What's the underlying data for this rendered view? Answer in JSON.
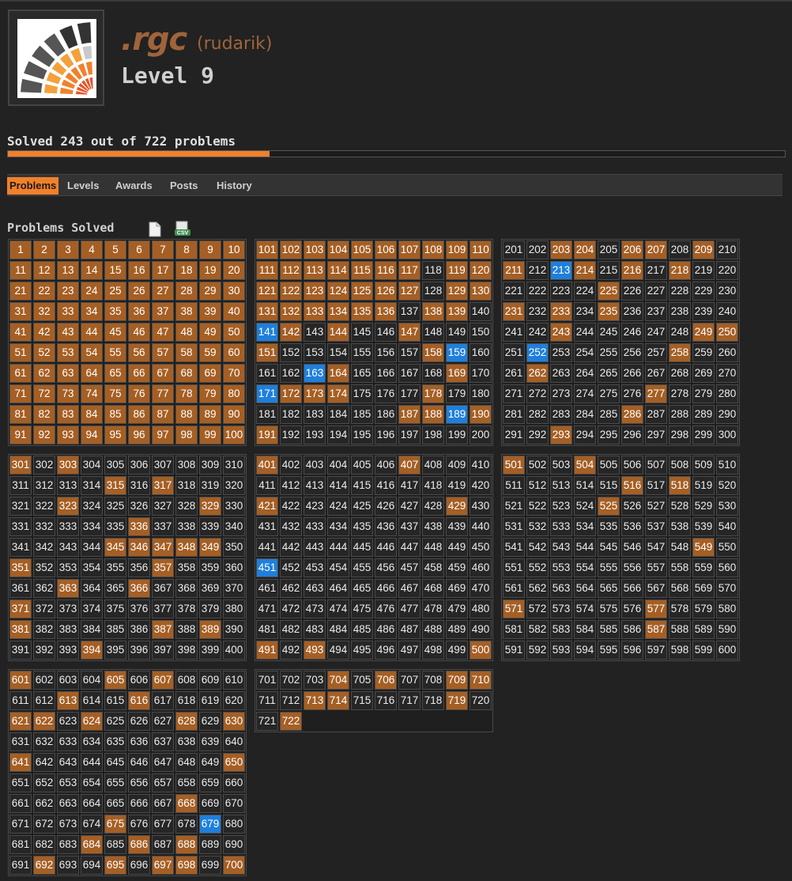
{
  "profile": {
    "username": ".rgc",
    "realname": "(rudarik)",
    "level": "Level 9"
  },
  "progress": {
    "text": "Solved 243 out of 722 problems",
    "solved": 243,
    "total": 722
  },
  "tabs": [
    {
      "label": "Problems",
      "active": true
    },
    {
      "label": "Levels",
      "active": false
    },
    {
      "label": "Awards",
      "active": false
    },
    {
      "label": "Posts",
      "active": false
    },
    {
      "label": "History",
      "active": false
    }
  ],
  "problems_section": {
    "title": "Problems Solved",
    "icons": [
      "document-icon",
      "csv-icon"
    ]
  },
  "colors": {
    "background": "#222222",
    "solved": "#a55f24",
    "highlight": "#1f7fdc",
    "accent": "#f0812b",
    "name": "#a0643a",
    "unsolved": "#262626"
  },
  "problem_grid": {
    "total": 722,
    "solved": [
      1,
      2,
      3,
      4,
      5,
      6,
      7,
      8,
      9,
      10,
      11,
      12,
      13,
      14,
      15,
      16,
      17,
      18,
      19,
      20,
      21,
      22,
      23,
      24,
      25,
      26,
      27,
      28,
      29,
      30,
      31,
      32,
      33,
      34,
      35,
      36,
      37,
      38,
      39,
      40,
      41,
      42,
      43,
      44,
      45,
      46,
      47,
      48,
      49,
      50,
      51,
      52,
      53,
      54,
      55,
      56,
      57,
      58,
      59,
      60,
      61,
      62,
      63,
      64,
      65,
      66,
      67,
      68,
      69,
      70,
      71,
      72,
      73,
      74,
      75,
      76,
      77,
      78,
      79,
      80,
      81,
      82,
      83,
      84,
      85,
      86,
      87,
      88,
      89,
      90,
      91,
      92,
      93,
      94,
      95,
      96,
      97,
      98,
      99,
      100,
      101,
      102,
      103,
      104,
      105,
      106,
      107,
      108,
      109,
      110,
      111,
      112,
      113,
      114,
      115,
      116,
      117,
      119,
      120,
      121,
      122,
      123,
      124,
      125,
      126,
      127,
      129,
      130,
      131,
      132,
      133,
      134,
      135,
      136,
      138,
      139,
      142,
      144,
      147,
      151,
      158,
      164,
      169,
      172,
      173,
      174,
      178,
      187,
      188,
      190,
      191,
      203,
      204,
      206,
      207,
      209,
      211,
      214,
      216,
      218,
      225,
      231,
      233,
      235,
      243,
      249,
      250,
      258,
      262,
      277,
      286,
      293,
      301,
      303,
      315,
      317,
      323,
      329,
      336,
      345,
      346,
      347,
      348,
      349,
      351,
      357,
      363,
      366,
      371,
      381,
      387,
      389,
      394,
      401,
      407,
      421,
      429,
      491,
      493,
      500,
      501,
      504,
      516,
      518,
      525,
      549,
      571,
      577,
      587,
      601,
      605,
      607,
      613,
      616,
      621,
      622,
      624,
      628,
      630,
      641,
      650,
      668,
      675,
      684,
      686,
      688,
      692,
      695,
      697,
      698,
      700,
      704,
      706,
      709,
      710,
      713,
      714,
      719,
      722
    ],
    "highlighted": [
      141,
      159,
      163,
      171,
      189,
      213,
      252,
      451,
      679
    ]
  }
}
